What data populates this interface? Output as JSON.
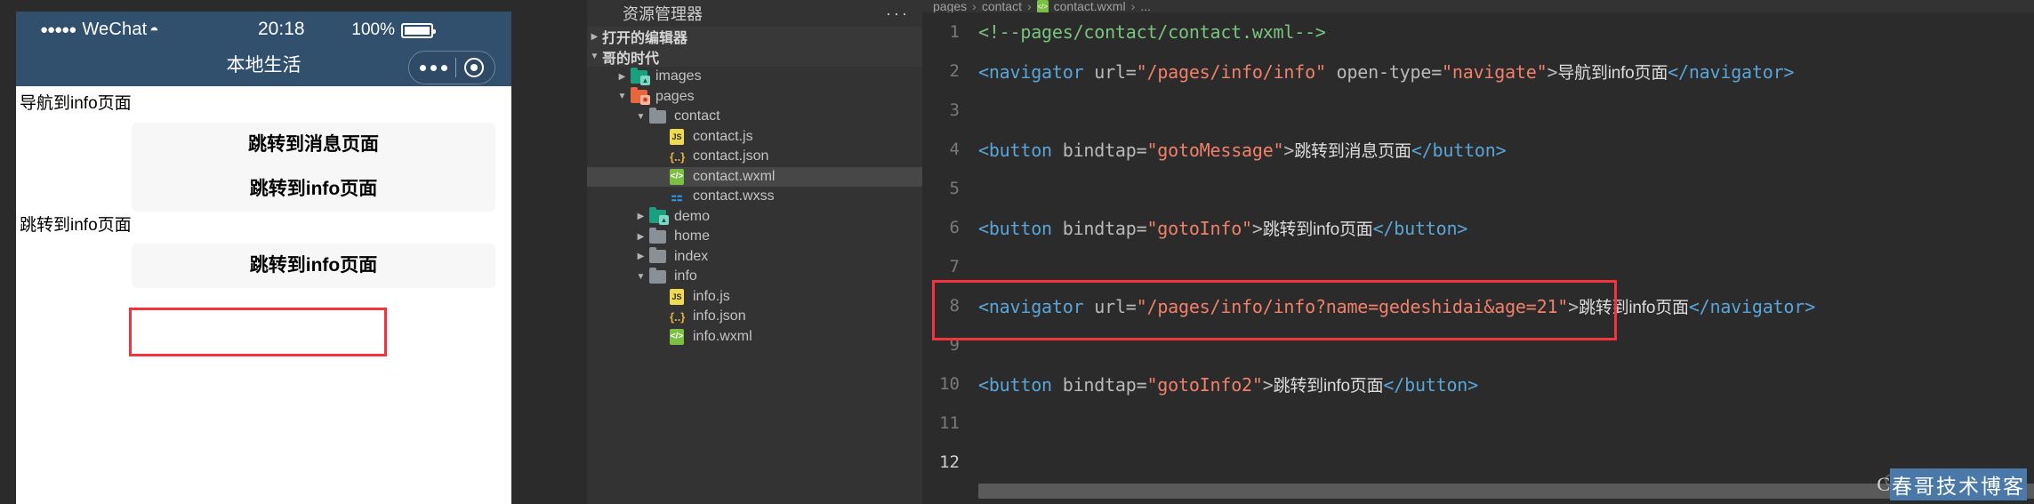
{
  "simulator": {
    "status_bar": {
      "carrier_dots": "●●●●●",
      "carrier": "WeChat",
      "wifi_icon": "wifi-icon",
      "time": "20:18",
      "battery_percent": "100%",
      "battery_icon": "battery-full-icon"
    },
    "page_title": "本地生活",
    "capsule": {
      "menu_icon": "more-dots-icon",
      "close_icon": "target-circle-icon"
    },
    "content": {
      "navigator_link_1": "导航到info页面",
      "button_message": "跳转到消息页面",
      "button_info": "跳转到info页面",
      "navigator_link_2": "跳转到info页面",
      "button_info2": "跳转到info页面"
    }
  },
  "explorer": {
    "title": "资源管理器",
    "more_actions": "···",
    "sections": [
      {
        "label": "打开的编辑器",
        "expanded": false
      },
      {
        "label": "哥的时代",
        "expanded": true
      }
    ],
    "tree": [
      {
        "label": "images",
        "kind": "folder-img",
        "depth": 1,
        "expanded": false,
        "selected": false
      },
      {
        "label": "pages",
        "kind": "folder-page",
        "depth": 1,
        "expanded": true,
        "selected": false
      },
      {
        "label": "contact",
        "kind": "folder",
        "depth": 2,
        "expanded": true,
        "selected": false
      },
      {
        "label": "contact.js",
        "kind": "js",
        "depth": 3,
        "selected": false
      },
      {
        "label": "contact.json",
        "kind": "json",
        "depth": 3,
        "selected": false
      },
      {
        "label": "contact.wxml",
        "kind": "wxml",
        "depth": 3,
        "selected": true
      },
      {
        "label": "contact.wxss",
        "kind": "wxss",
        "depth": 3,
        "selected": false
      },
      {
        "label": "demo",
        "kind": "folder-img",
        "depth": 2,
        "expanded": false,
        "selected": false
      },
      {
        "label": "home",
        "kind": "folder",
        "depth": 2,
        "expanded": false,
        "selected": false
      },
      {
        "label": "index",
        "kind": "folder",
        "depth": 2,
        "expanded": false,
        "selected": false
      },
      {
        "label": "info",
        "kind": "folder",
        "depth": 2,
        "expanded": true,
        "selected": false
      },
      {
        "label": "info.js",
        "kind": "js",
        "depth": 3,
        "selected": false
      },
      {
        "label": "info.json",
        "kind": "json",
        "depth": 3,
        "selected": false
      },
      {
        "label": "info.wxml",
        "kind": "wxml",
        "depth": 3,
        "selected": false
      }
    ]
  },
  "editor": {
    "breadcrumb": [
      "pages",
      "contact",
      "contact.wxml",
      "..."
    ],
    "breadcrumb_file_icon": "wxml-file-icon",
    "lines": [
      {
        "n": "1",
        "tokens": [
          {
            "t": "cmt",
            "v": "<!--pages/contact/contact.wxml-->"
          }
        ]
      },
      {
        "n": "2",
        "tokens": [
          {
            "t": "tag",
            "v": "<navigator"
          },
          {
            "t": "attr",
            "v": " url="
          },
          {
            "t": "str",
            "v": "\"/pages/info/info\""
          },
          {
            "t": "attr",
            "v": " open-type="
          },
          {
            "t": "str",
            "v": "\"navigate\""
          },
          {
            "t": "punc",
            "v": ">"
          },
          {
            "t": "txt",
            "v": "导航到info页面"
          },
          {
            "t": "tag",
            "v": "</navigator>"
          }
        ]
      },
      {
        "n": "3",
        "tokens": []
      },
      {
        "n": "4",
        "tokens": [
          {
            "t": "tag",
            "v": "<button"
          },
          {
            "t": "attr",
            "v": " bindtap="
          },
          {
            "t": "str",
            "v": "\"gotoMessage\""
          },
          {
            "t": "punc",
            "v": ">"
          },
          {
            "t": "txt",
            "v": "跳转到消息页面"
          },
          {
            "t": "tag",
            "v": "</button>"
          }
        ]
      },
      {
        "n": "5",
        "tokens": []
      },
      {
        "n": "6",
        "tokens": [
          {
            "t": "tag",
            "v": "<button"
          },
          {
            "t": "attr",
            "v": " bindtap="
          },
          {
            "t": "str",
            "v": "\"gotoInfo\""
          },
          {
            "t": "punc",
            "v": ">"
          },
          {
            "t": "txt",
            "v": "跳转到info页面"
          },
          {
            "t": "tag",
            "v": "</button>"
          }
        ]
      },
      {
        "n": "7",
        "tokens": []
      },
      {
        "n": "8",
        "tokens": [
          {
            "t": "tag",
            "v": "<navigator"
          },
          {
            "t": "attr",
            "v": " url="
          },
          {
            "t": "str",
            "v": "\"/pages/info/info?name=gedeshidai&age=21\""
          },
          {
            "t": "punc",
            "v": ">"
          },
          {
            "t": "txt",
            "v": "跳转到info页面"
          },
          {
            "t": "tag",
            "v": "</navigator>"
          }
        ]
      },
      {
        "n": "9",
        "tokens": []
      },
      {
        "n": "10",
        "tokens": [
          {
            "t": "tag",
            "v": "<button"
          },
          {
            "t": "attr",
            "v": " bindtap="
          },
          {
            "t": "str",
            "v": "\"gotoInfo2\""
          },
          {
            "t": "punc",
            "v": ">"
          },
          {
            "t": "txt",
            "v": "跳转到info页面"
          },
          {
            "t": "tag",
            "v": "</button>"
          }
        ],
        "highlighted": true
      },
      {
        "n": "11",
        "tokens": []
      },
      {
        "n": "12",
        "tokens": [],
        "current": true
      }
    ]
  },
  "watermark": {
    "prefix": "C",
    "faint": "CSDN @哥的时代",
    "text": "春哥技术博客"
  },
  "colors": {
    "accent_red": "#f4333c",
    "wechat_header": "#31506e",
    "editor_bg": "#2b2b2b",
    "explorer_bg": "#333333"
  }
}
